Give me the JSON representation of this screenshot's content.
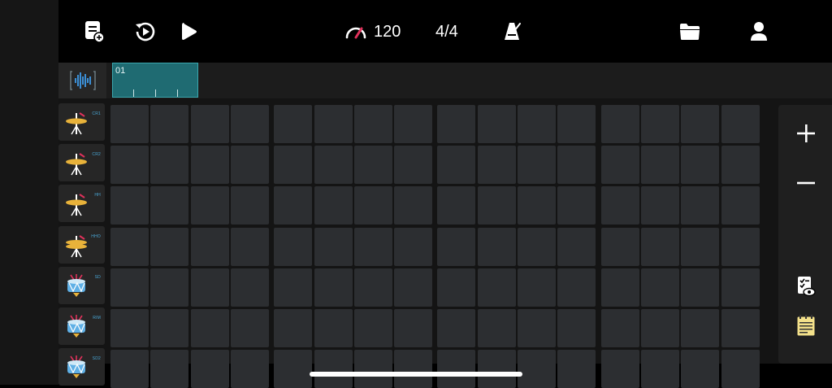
{
  "topbar": {
    "tempo_value": "120",
    "time_signature": "4/4",
    "icons": [
      "new-project-icon",
      "history-icon",
      "play-icon",
      "tempo-gauge-icon",
      "metronome-icon",
      "folder-icon",
      "user-icon"
    ]
  },
  "timeline": {
    "pattern_label": "01"
  },
  "instruments": [
    {
      "abbr": "CR1",
      "icon": "crash-cymbal-icon"
    },
    {
      "abbr": "CR2",
      "icon": "crash-cymbal-icon"
    },
    {
      "abbr": "HH",
      "icon": "hihat-closed-icon"
    },
    {
      "abbr": "HHO",
      "icon": "hihat-open-icon"
    },
    {
      "abbr": "SD",
      "icon": "snare-drum-icon"
    },
    {
      "abbr": "RIM",
      "icon": "rimshot-icon"
    },
    {
      "abbr": "SD2",
      "icon": "snare-drum-icon"
    }
  ],
  "grid": {
    "steps": 16,
    "rows": 7
  },
  "side_panel": {
    "icons": [
      "add-icon",
      "remove-icon",
      "view-checklist-icon",
      "notes-icon"
    ]
  },
  "colors": {
    "accent_teal": "#1f6b72",
    "cell": "#2c2e31",
    "cymbal_gold": "#e8b23a",
    "tempo_red": "#e0315b"
  }
}
